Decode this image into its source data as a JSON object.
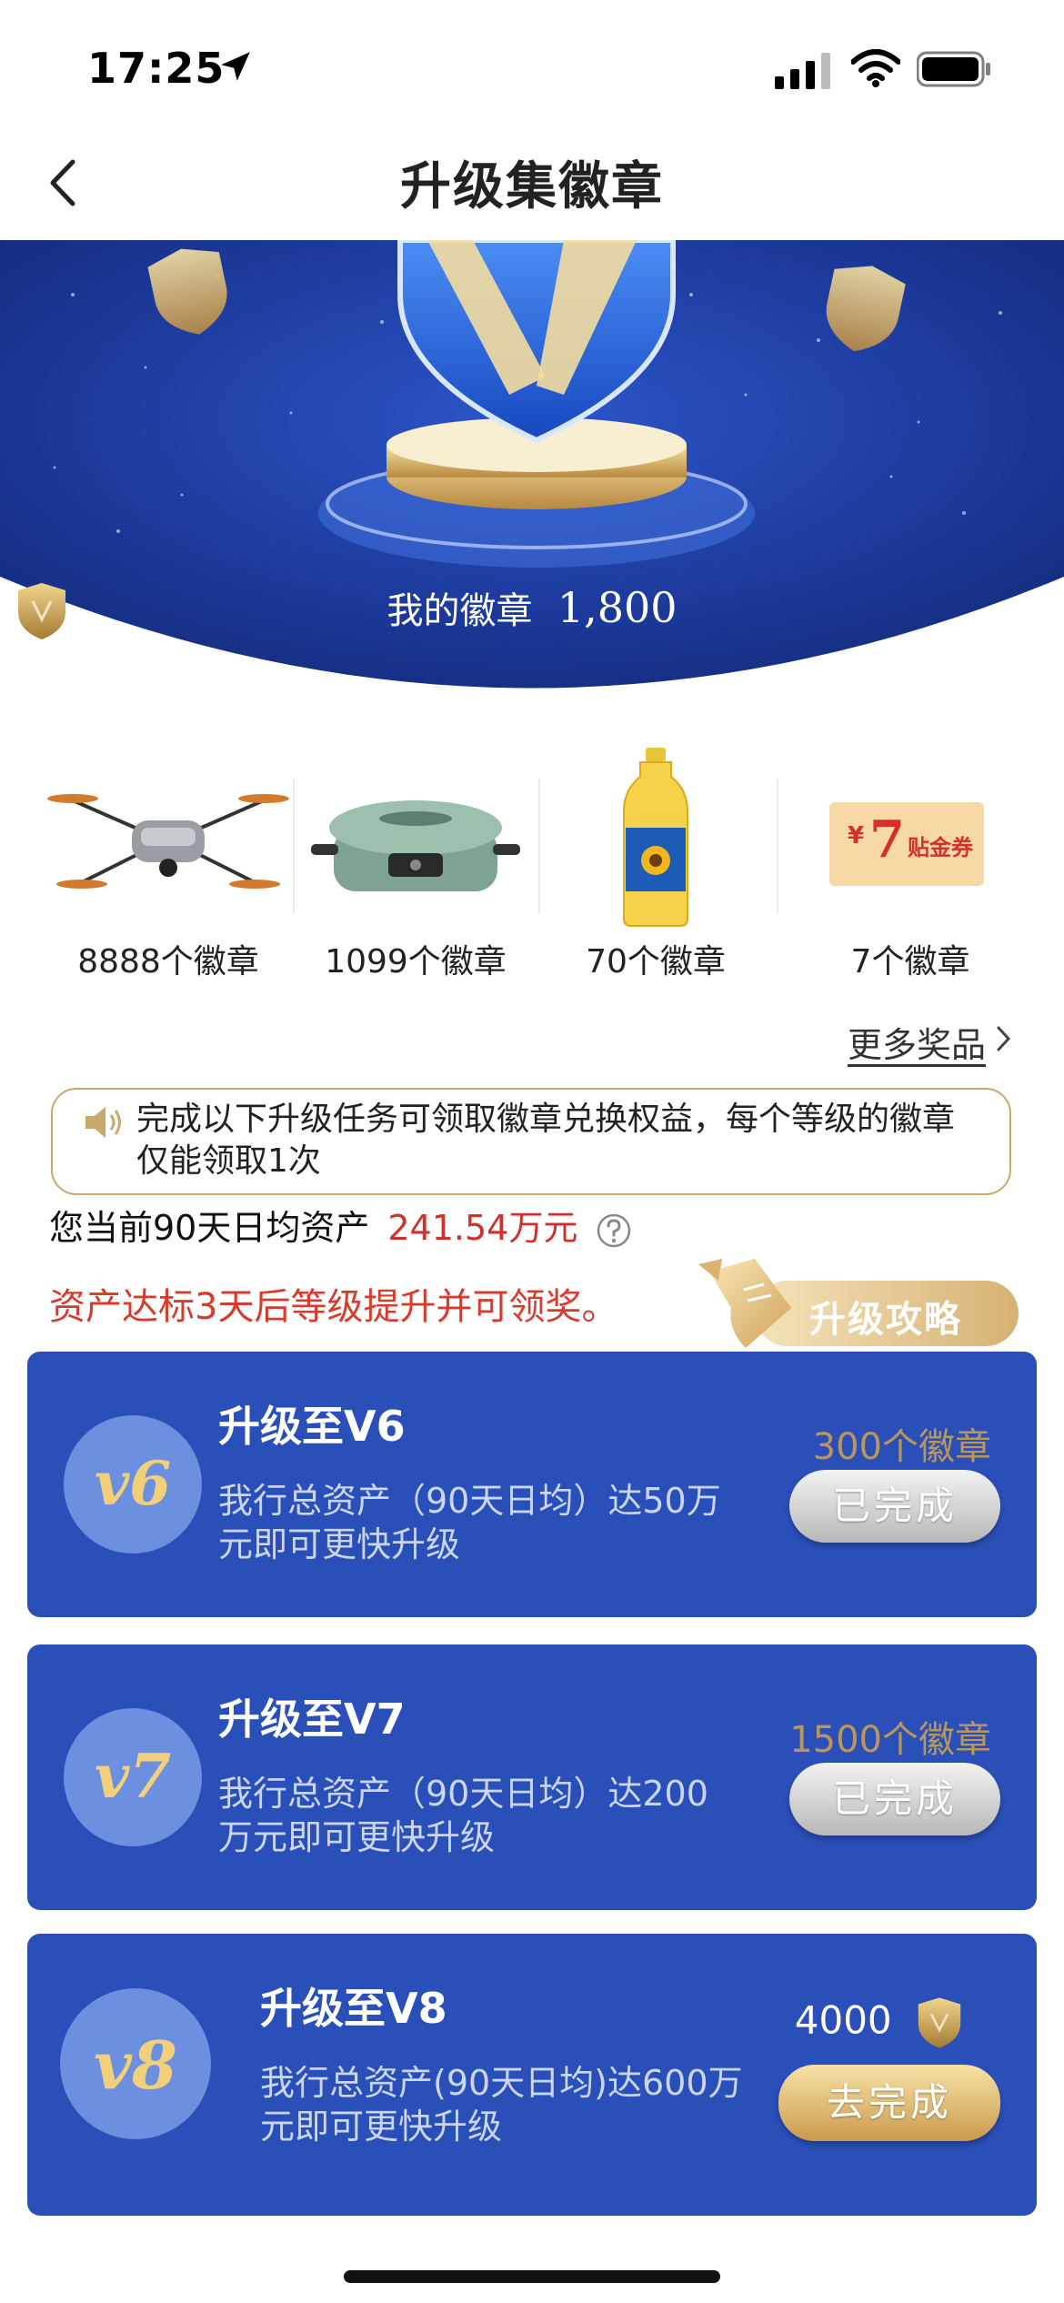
{
  "status_bar": {
    "time": "17:25"
  },
  "nav": {
    "title": "升级集徽章"
  },
  "hero": {
    "badge_label": "我的徽章",
    "badge_count": "1,800"
  },
  "prizes": [
    {
      "name": "drone",
      "label": "8888个徽章"
    },
    {
      "name": "grill-pan",
      "label": "1099个徽章"
    },
    {
      "name": "cooking-oil",
      "label": "70个徽章"
    },
    {
      "name": "coupon",
      "label": "7个徽章",
      "coupon_amount": "7",
      "coupon_currency": "¥",
      "coupon_text": "贴金券"
    }
  ],
  "more_prizes": "更多奖品",
  "notice": {
    "text": "完成以下升级任务可领取徽章兑换权益，每个等级的徽章仅能领取1次"
  },
  "assets": {
    "label": "您当前90天日均资产",
    "value": "241.54万元"
  },
  "assets_note": "资产达标3天后等级提升并可领奖。",
  "guide": {
    "label": "升级攻略"
  },
  "levels": [
    {
      "badge": "v6",
      "title": "升级至V6",
      "desc": "我行总资产（90天日均）达50万元即可更快升级",
      "reward": "300个徽章",
      "button": "已完成",
      "status": "done"
    },
    {
      "badge": "v7",
      "title": "升级至V7",
      "desc": "我行总资产（90天日均）达200万元即可更快升级",
      "reward": "1500个徽章",
      "button": "已完成",
      "status": "done"
    },
    {
      "badge": "v8",
      "title": "升级至V8",
      "desc": "我行总资产(90天日均)达600万元即可更快升级",
      "reward": "4000",
      "button": "去完成",
      "status": "todo"
    }
  ],
  "colors": {
    "primary_blue": "#2a4fb8",
    "gold": "#c99a4c",
    "alert_red": "#d0302c"
  }
}
